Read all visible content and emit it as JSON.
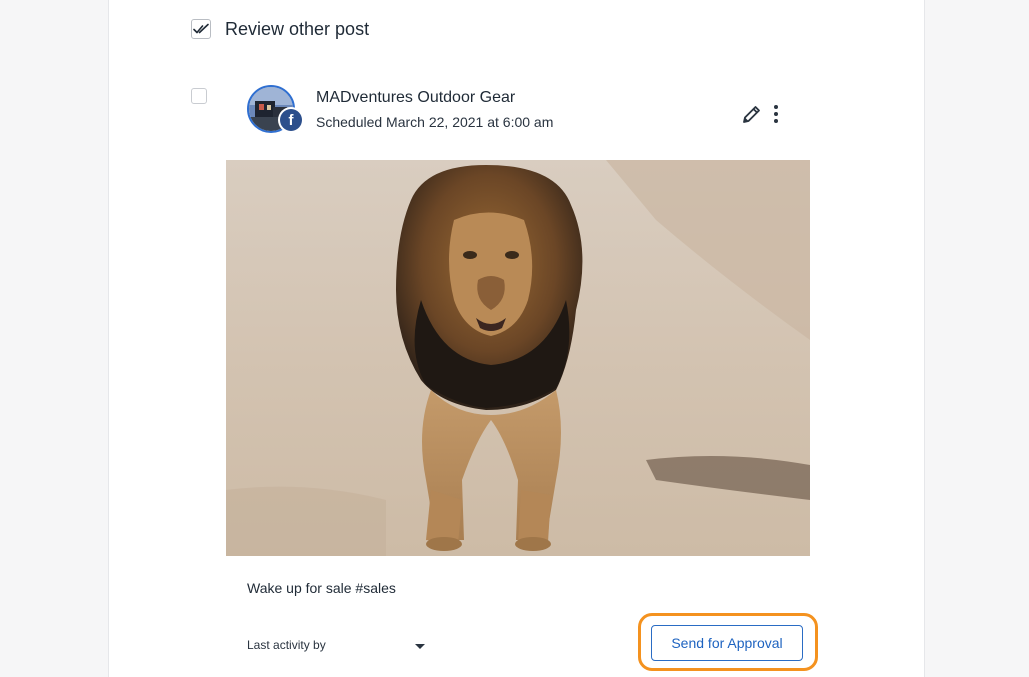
{
  "section": {
    "title": "Review other post",
    "checked": true
  },
  "post": {
    "account_name": "MADventures Outdoor Gear",
    "network": "facebook",
    "schedule": "Scheduled March 22, 2021 at 6:00 am",
    "caption": "Wake up for sale #sales",
    "image_subject": "lion walking on dirt road"
  },
  "footer": {
    "activity_label": "Last activity by",
    "approval_button_label": "Send for Approval"
  },
  "icons": {
    "section_check": "double-check-icon",
    "edit": "pencil-icon",
    "more": "vertical-ellipsis-icon",
    "dropdown": "caret-down-icon",
    "network_badge": "facebook-icon"
  },
  "colors": {
    "accent": "#1e63c0",
    "highlight": "#f4921f",
    "facebook": "#2c4f8c"
  }
}
